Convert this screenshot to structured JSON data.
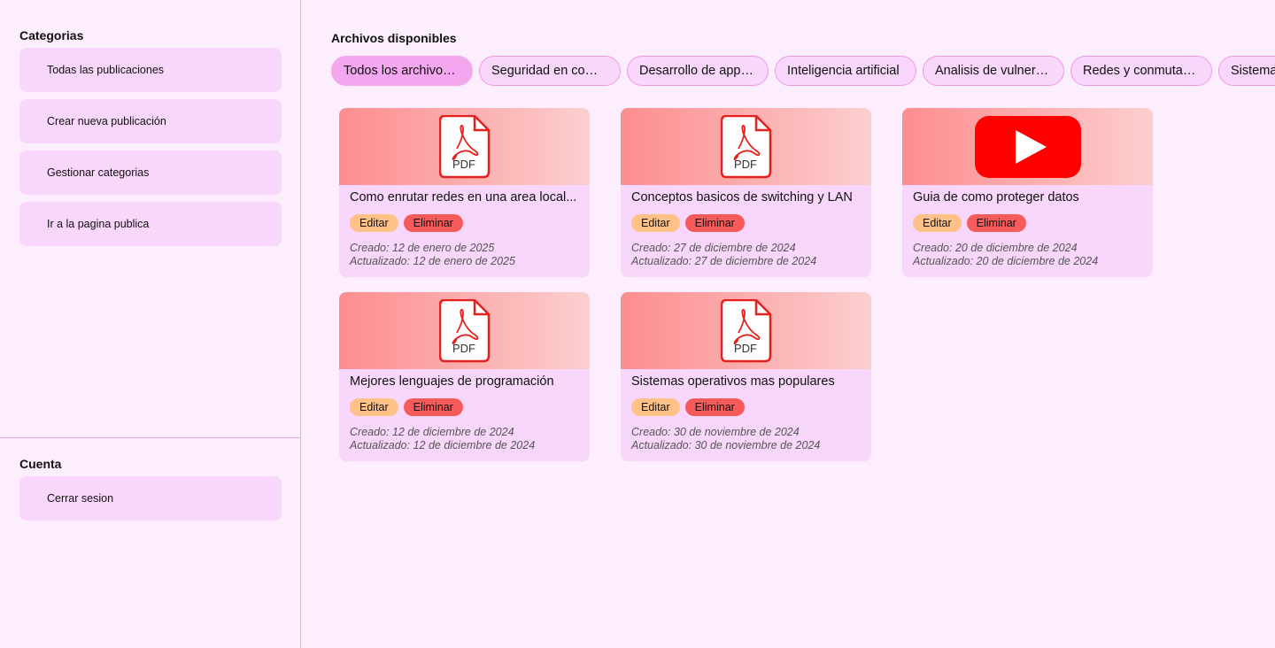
{
  "sidebar": {
    "categories_title": "Categorias",
    "items": [
      {
        "label": "Todas las publicaciones"
      },
      {
        "label": "Crear nueva publicación"
      },
      {
        "label": "Gestionar categorias"
      },
      {
        "label": "Ir a la pagina publica"
      }
    ],
    "account_title": "Cuenta",
    "logout_label": "Cerrar sesion"
  },
  "main": {
    "title": "Archivos disponibles",
    "chips": [
      {
        "label": "Todos los archivos disponibles",
        "active": true
      },
      {
        "label": "Seguridad en computadoras"
      },
      {
        "label": "Desarrollo de apps moviles"
      },
      {
        "label": "Inteligencia artificial"
      },
      {
        "label": "Analisis de vulnerabilidades"
      },
      {
        "label": "Redes y conmutadores"
      },
      {
        "label": "Sistemas operativos"
      }
    ],
    "cards": [
      {
        "type": "pdf",
        "title": "Como enrutar redes en una area local...",
        "edit": "Editar",
        "delete": "Eliminar",
        "created": "Creado: 12 de enero de 2025",
        "updated": "Actualizado: 12 de enero de 2025"
      },
      {
        "type": "pdf",
        "title": "Conceptos basicos de switching y LAN",
        "edit": "Editar",
        "delete": "Eliminar",
        "created": "Creado: 27 de diciembre de 2024",
        "updated": "Actualizado: 27 de diciembre de 2024"
      },
      {
        "type": "video",
        "title": "Guia de como proteger datos",
        "edit": "Editar",
        "delete": "Eliminar",
        "created": "Creado: 20 de diciembre de 2024",
        "updated": "Actualizado: 20 de diciembre de 2024"
      },
      {
        "type": "pdf",
        "title": "Mejores lenguajes de programación",
        "edit": "Editar",
        "delete": "Eliminar",
        "created": "Creado: 12 de diciembre de 2024",
        "updated": "Actualizado: 12 de diciembre de 2024"
      },
      {
        "type": "pdf",
        "title": "Sistemas operativos mas populares",
        "edit": "Editar",
        "delete": "Eliminar",
        "created": "Creado: 30 de noviembre de 2024",
        "updated": "Actualizado: 30 de noviembre de 2024"
      }
    ],
    "pdf_label": "PDF"
  },
  "icons": {
    "pdf": "pdf-file-icon",
    "video": "youtube-play-icon"
  },
  "colors": {
    "accent_chip": "#f4a6ef",
    "edit": "#fec289",
    "delete": "#f65b5c",
    "youtube": "#ff0000"
  }
}
